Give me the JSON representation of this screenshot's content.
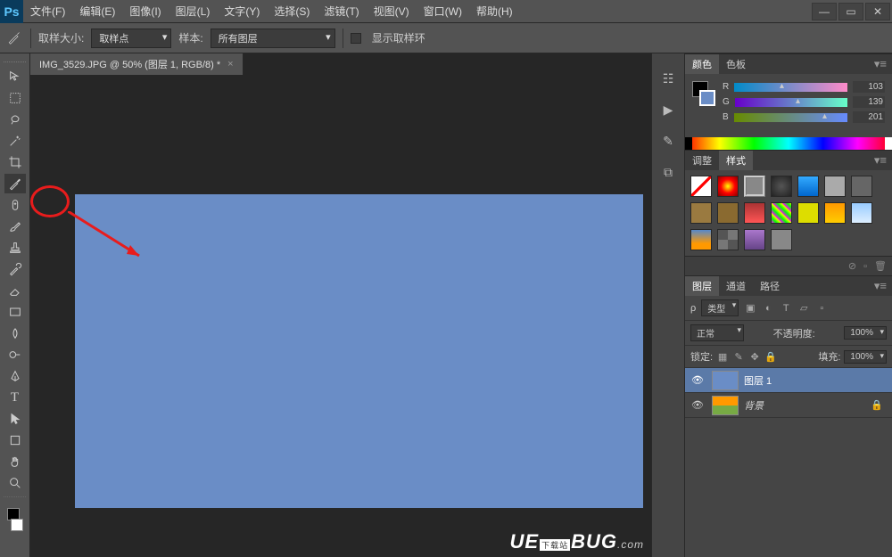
{
  "menu": {
    "items": [
      "文件(F)",
      "编辑(E)",
      "图像(I)",
      "图层(L)",
      "文字(Y)",
      "选择(S)",
      "滤镜(T)",
      "视图(V)",
      "窗口(W)",
      "帮助(H)"
    ]
  },
  "options": {
    "sample_label": "取样大小:",
    "sample_value": "取样点",
    "sample2_label": "样本:",
    "sample2_value": "所有图层",
    "ring_label": "显示取样环"
  },
  "document": {
    "tab": "IMG_3529.JPG @ 50% (图层 1, RGB/8) *"
  },
  "color": {
    "tab1": "颜色",
    "tab2": "色板",
    "r": "R",
    "g": "G",
    "b": "B",
    "rv": "103",
    "gv": "139",
    "bv": "201"
  },
  "adjust": {
    "tab1": "调整",
    "tab2": "样式"
  },
  "layers": {
    "tab1": "图层",
    "tab2": "通道",
    "tab3": "路径",
    "kind": "类型",
    "blend": "正常",
    "opacity_l": "不透明度:",
    "opacity_v": "100%",
    "lock": "锁定:",
    "fill_l": "填充:",
    "fill_v": "100%",
    "layer1": "图层 1",
    "bg": "背景"
  },
  "watermark": {
    "t1": "UE",
    "t2": "BUG",
    "badge": "下载站",
    "t3": ".com"
  }
}
